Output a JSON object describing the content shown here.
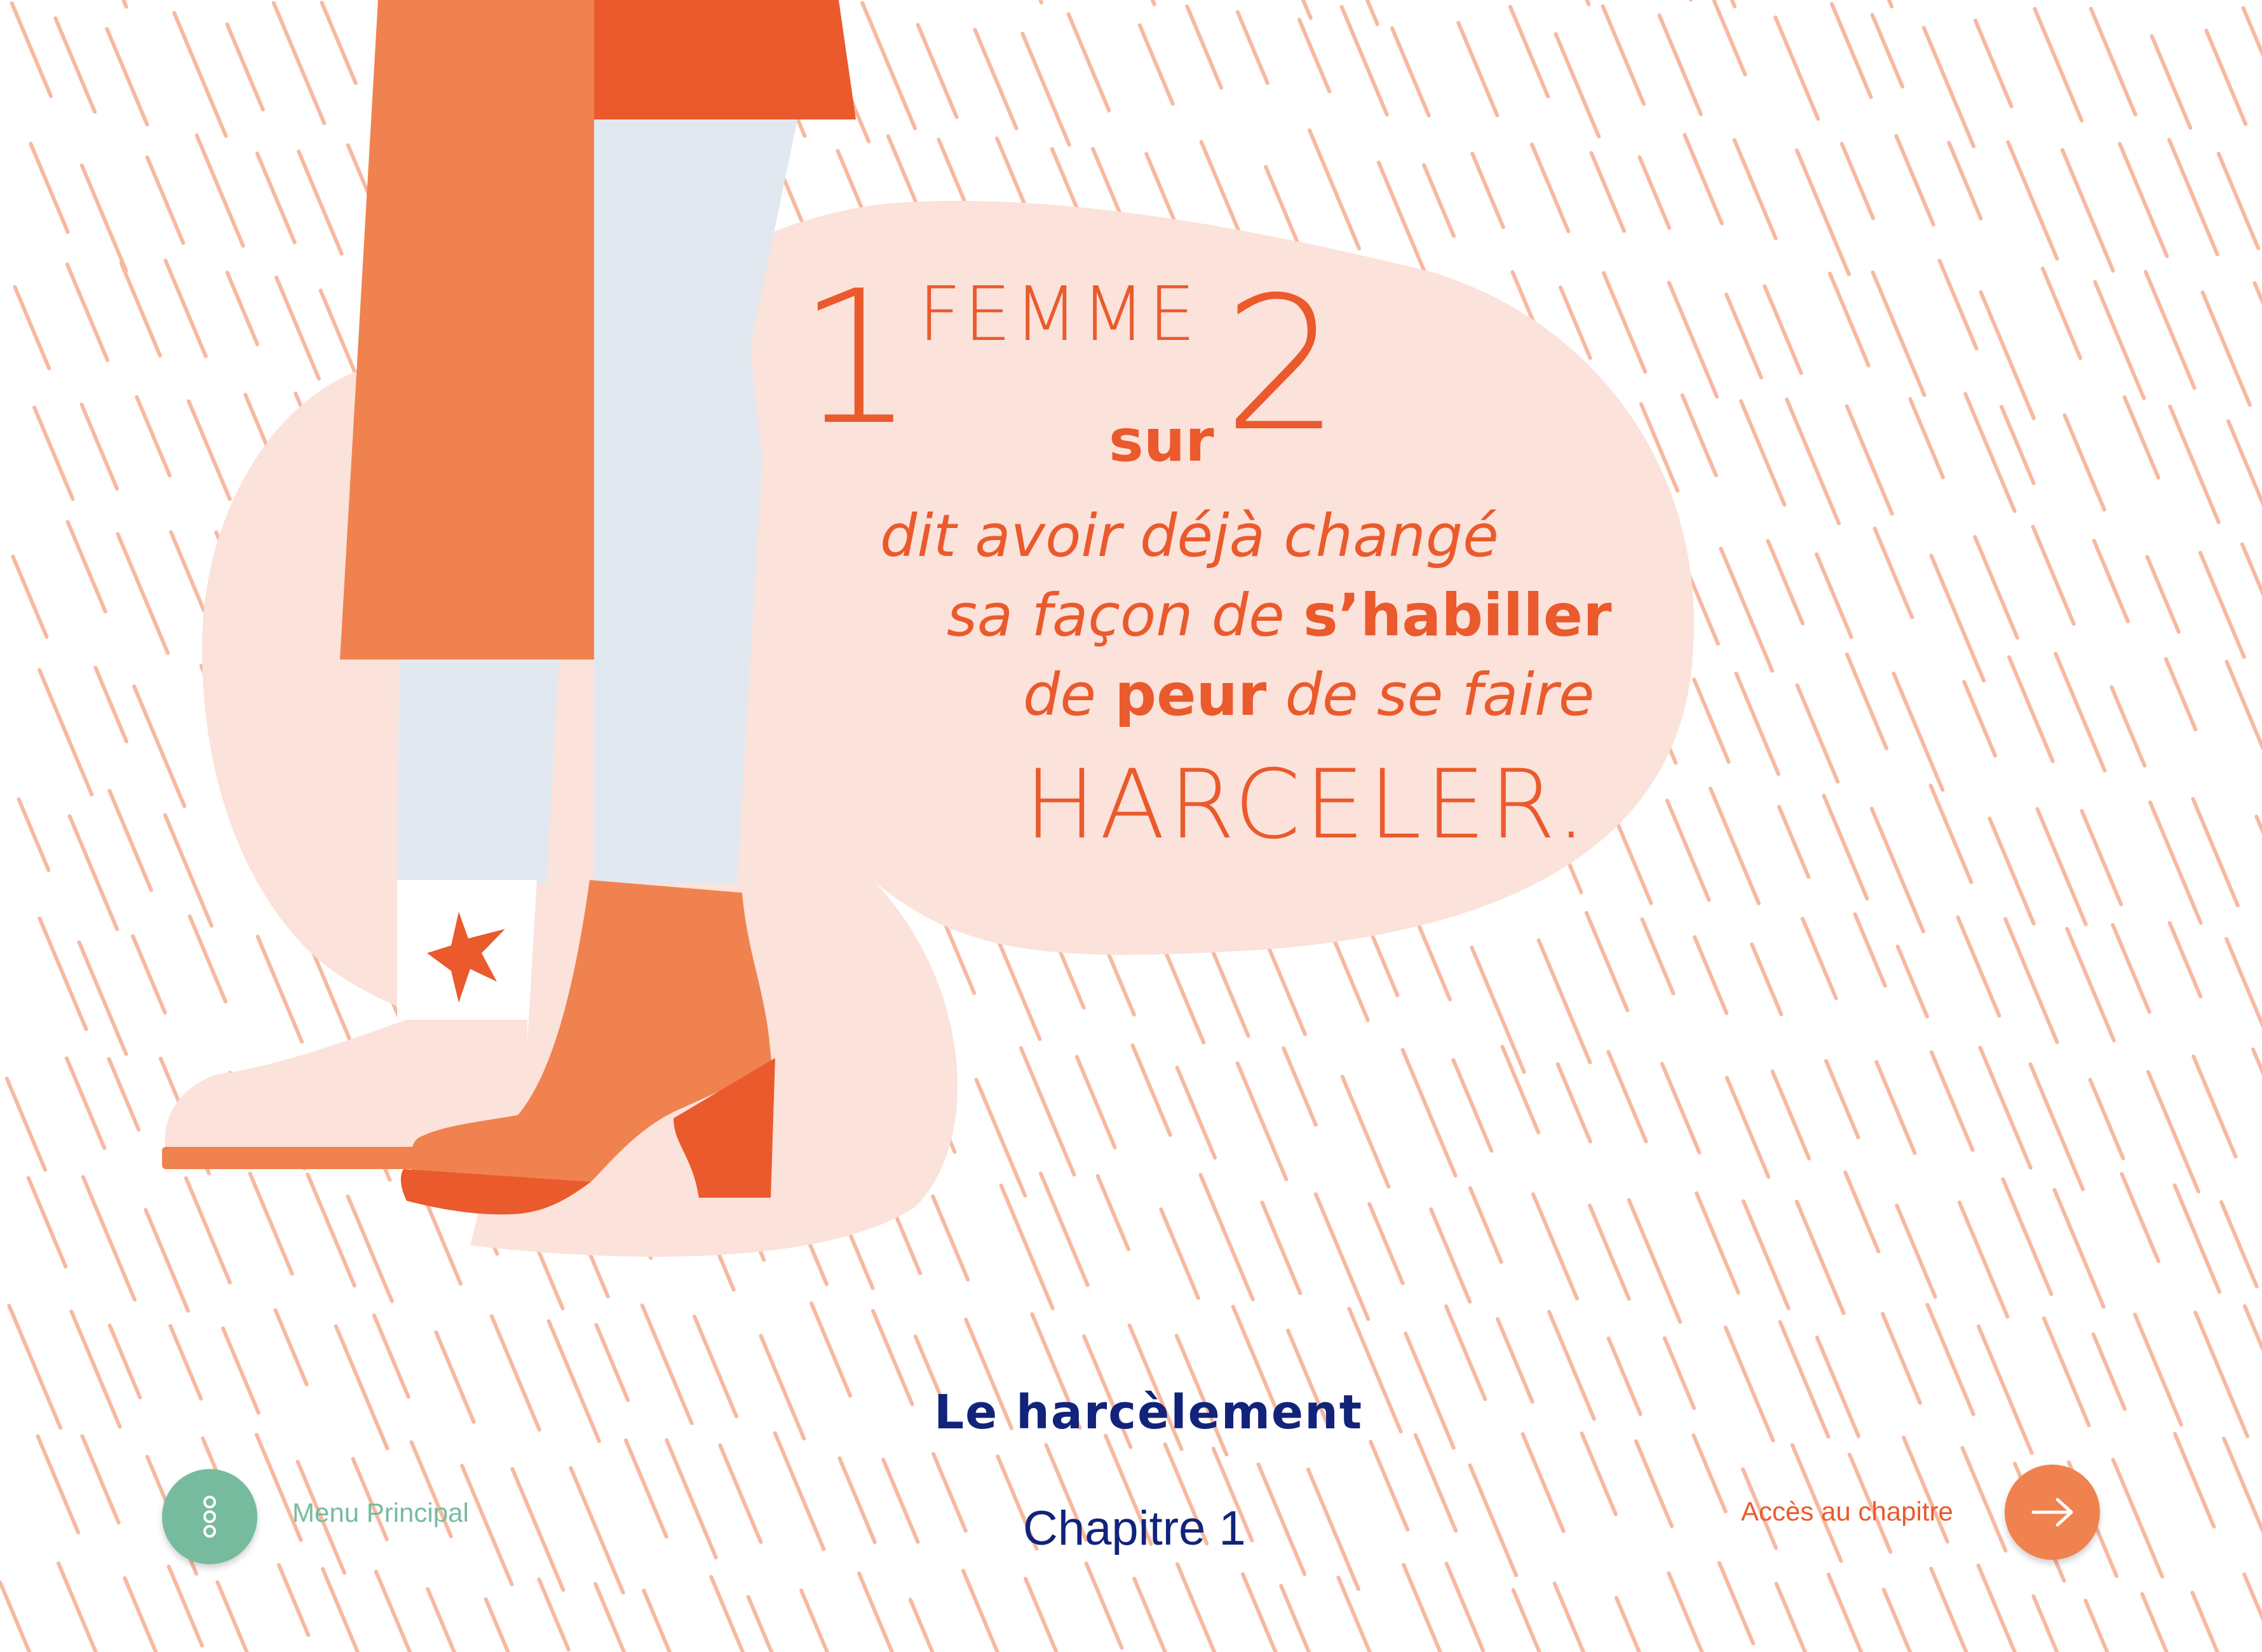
{
  "colors": {
    "orange_dark": "#ea5a2c",
    "orange_light": "#f0824f",
    "peach": "#fbe2da",
    "rain": "#f7b9a0",
    "jeans": "#e1e8f0",
    "navy": "#12237a",
    "green": "#77bb9e"
  },
  "stat": {
    "number_one": "1",
    "femme": "FEMME",
    "sur": "sur",
    "number_two": "2",
    "line1": "dit avoir déjà changé",
    "line2_pre": "sa façon de ",
    "line2_bold": "s’habiller",
    "line3_pre": "de ",
    "line3_bold": "peur",
    "line3_post": " de se faire",
    "line4": "HARCELER."
  },
  "chapter": {
    "title": "Le harcèlement",
    "number": "Chapitre 1"
  },
  "nav": {
    "menu_label": "Menu Principal",
    "menu_icon": "vertical-dots-icon",
    "access_label": "Accès au chapitre",
    "access_icon": "arrow-right-icon"
  }
}
